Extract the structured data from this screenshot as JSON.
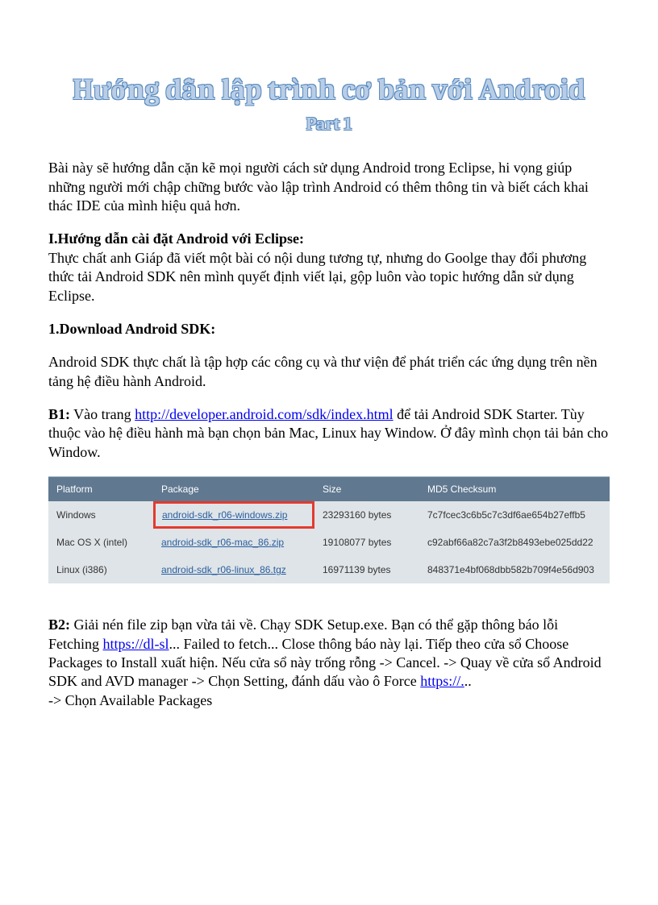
{
  "title": "Hướng dẫn lập trình cơ bản với Android",
  "subtitle": "Part 1",
  "intro": "Bài này sẽ hướng dẫn cặn kẽ mọi người cách sử dụng Android trong Eclipse, hi vọng giúp những người mới chập chững bước vào lập trình Android có thêm thông tin và biết cách khai thác IDE của mình hiệu quả hơn.",
  "section1_heading": "I.Hướng dẫn cài đặt Android với Eclipse:",
  "section1_body": "Thực chất anh Giáp đã viết một bài có nội dung tương tự, nhưng do Goolge thay đổi phương thức tải Android SDK nên mình quyết định viết lại, gộp luôn vào topic hướng dẫn sử dụng Eclipse.",
  "section1_sub": "1.Download Android SDK:",
  "sdk_desc": "Android SDK thực chất là tập hợp các công cụ và thư viện để phát triển các ứng dụng trên nền tảng hệ điều hành Android.",
  "b1_label": "B1:",
  "b1_pre": " Vào trang ",
  "b1_link": "http://developer.android.com/sdk/index.html",
  "b1_post": " để tải Android SDK Starter. Tùy thuộc vào hệ điều hành mà bạn chọn bản Mac, Linux hay Window. Ở đây mình chọn tải bản cho Window.",
  "table": {
    "headers": [
      "Platform",
      "Package",
      "Size",
      "MD5 Checksum"
    ],
    "rows": [
      {
        "platform": "Windows",
        "package": "android-sdk_r06-windows.zip",
        "size": "23293160 bytes",
        "md5": "7c7fcec3c6b5c7c3df6ae654b27effb5",
        "highlight": true
      },
      {
        "platform": "Mac OS X (intel)",
        "package": "android-sdk_r06-mac_86.zip",
        "size": "19108077 bytes",
        "md5": "c92abf66a82c7a3f2b8493ebe025dd22",
        "highlight": false
      },
      {
        "platform": "Linux (i386)",
        "package": "android-sdk_r06-linux_86.tgz",
        "size": "16971139 bytes",
        "md5": "848371e4bf068dbb582b709f4e56d903",
        "highlight": false
      }
    ]
  },
  "b2_label": "B2:",
  "b2_pre": " Giải nén file zip bạn vừa tải về. Chạy SDK Setup.exe. Bạn có thể gặp thông báo lỗi Fetching ",
  "b2_link1": "https://dl-sl",
  "b2_mid": "... Failed to fetch... Close thông báo này lại. Tiếp theo cửa sổ Choose Packages to Install xuất hiện. Nếu cửa sổ này trống rỗng -> Cancel. -> Quay về cửa sổ Android SDK and AVD manager -> Chọn Setting, đánh dấu vào ô Force ",
  "b2_link2": "https://.",
  "b2_post": "..",
  "b2_last": "-> Chọn Available Packages"
}
